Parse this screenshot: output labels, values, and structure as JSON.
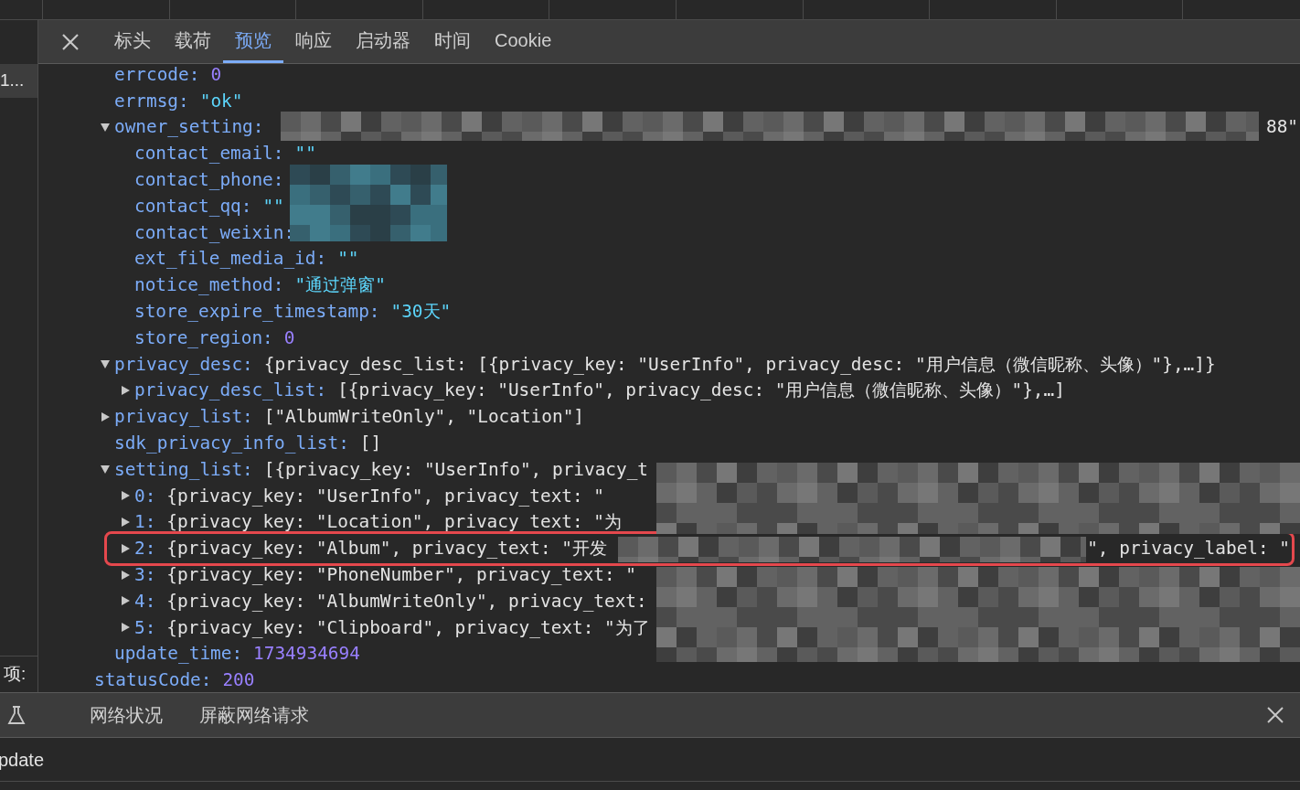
{
  "left_column": {
    "items": [
      {
        "label": "1...",
        "selected": true
      }
    ],
    "footer": "项:"
  },
  "tabs": [
    {
      "label": "标头",
      "selected": false
    },
    {
      "label": "载荷",
      "selected": false
    },
    {
      "label": "预览",
      "selected": true
    },
    {
      "label": "响应",
      "selected": false
    },
    {
      "label": "启动器",
      "selected": false
    },
    {
      "label": "时间",
      "selected": false
    },
    {
      "label": "Cookie",
      "selected": false
    }
  ],
  "tree": [
    {
      "children": [
        {
          "key": "errcode:",
          "value": "0",
          "kind": "number"
        },
        {
          "key": "errmsg:",
          "value": "\"ok\"",
          "kind": "string"
        },
        {
          "key": "owner_setting:",
          "kind": "redacted",
          "tail": "88\"",
          "expanded": true,
          "children": [
            {
              "key": "contact_email:",
              "value": "\"\"",
              "kind": "string"
            },
            {
              "key": "contact_phone:",
              "kind": "redacted"
            },
            {
              "key": "contact_qq:",
              "value": "\"\"",
              "kind": "string"
            },
            {
              "key": "contact_weixin:",
              "kind": "redacted"
            },
            {
              "key": "ext_file_media_id:",
              "value": "\"\"",
              "kind": "string"
            },
            {
              "key": "notice_method:",
              "value": "\"通过弹窗\"",
              "kind": "string"
            },
            {
              "key": "store_expire_timestamp:",
              "value": "\"30天\"",
              "kind": "string"
            },
            {
              "key": "store_region:",
              "value": "0",
              "kind": "number"
            }
          ]
        },
        {
          "key": "privacy_desc:",
          "value": "{privacy_desc_list: [{privacy_key: \"UserInfo\", privacy_desc: \"用户信息（微信昵称、头像）\"},…]}",
          "kind": "object",
          "expanded": true,
          "children": [
            {
              "key": "privacy_desc_list:",
              "value": "[{privacy_key: \"UserInfo\", privacy_desc: \"用户信息（微信昵称、头像）\"},…]",
              "kind": "object",
              "expanded": false
            }
          ]
        },
        {
          "key": "privacy_list:",
          "value": "[\"AlbumWriteOnly\", \"Location\"]",
          "kind": "object",
          "expanded": false
        },
        {
          "key": "sdk_privacy_info_list:",
          "value": "[]",
          "kind": "object"
        },
        {
          "key": "setting_list:",
          "value": "[{privacy_key: \"UserInfo\", privacy_t",
          "kind": "object",
          "expanded": true,
          "children": [
            {
              "key": "0:",
              "value": "{privacy_key: \"UserInfo\", privacy_text: \"",
              "kind": "object",
              "expanded": false
            },
            {
              "key": "1:",
              "value": "{privacy_key: \"Location\", privacy_text: \"为",
              "kind": "object",
              "expanded": false
            },
            {
              "key": "2:",
              "value": "{privacy_key: \"Album\", privacy_text: \"开发",
              "kind": "object",
              "expanded": false,
              "tail": "\", privacy_label: \"",
              "highlighted": true
            },
            {
              "key": "3:",
              "value": "{privacy_key: \"PhoneNumber\", privacy_text: \"",
              "kind": "object",
              "expanded": false
            },
            {
              "key": "4:",
              "value": "{privacy_key: \"AlbumWriteOnly\", privacy_text:",
              "kind": "object",
              "expanded": false
            },
            {
              "key": "5:",
              "value": "{privacy_key: \"Clipboard\", privacy_text: \"为了",
              "kind": "object",
              "expanded": false
            }
          ]
        },
        {
          "key": "update_time:",
          "value": "1734934694",
          "kind": "number"
        }
      ]
    },
    {
      "key": "statusCode:",
      "value": "200",
      "kind": "number"
    }
  ],
  "drawer_tabs": [
    {
      "label": "网络状况"
    },
    {
      "label": "屏蔽网络请求"
    }
  ],
  "bottom_row": {
    "text": "pdate"
  }
}
